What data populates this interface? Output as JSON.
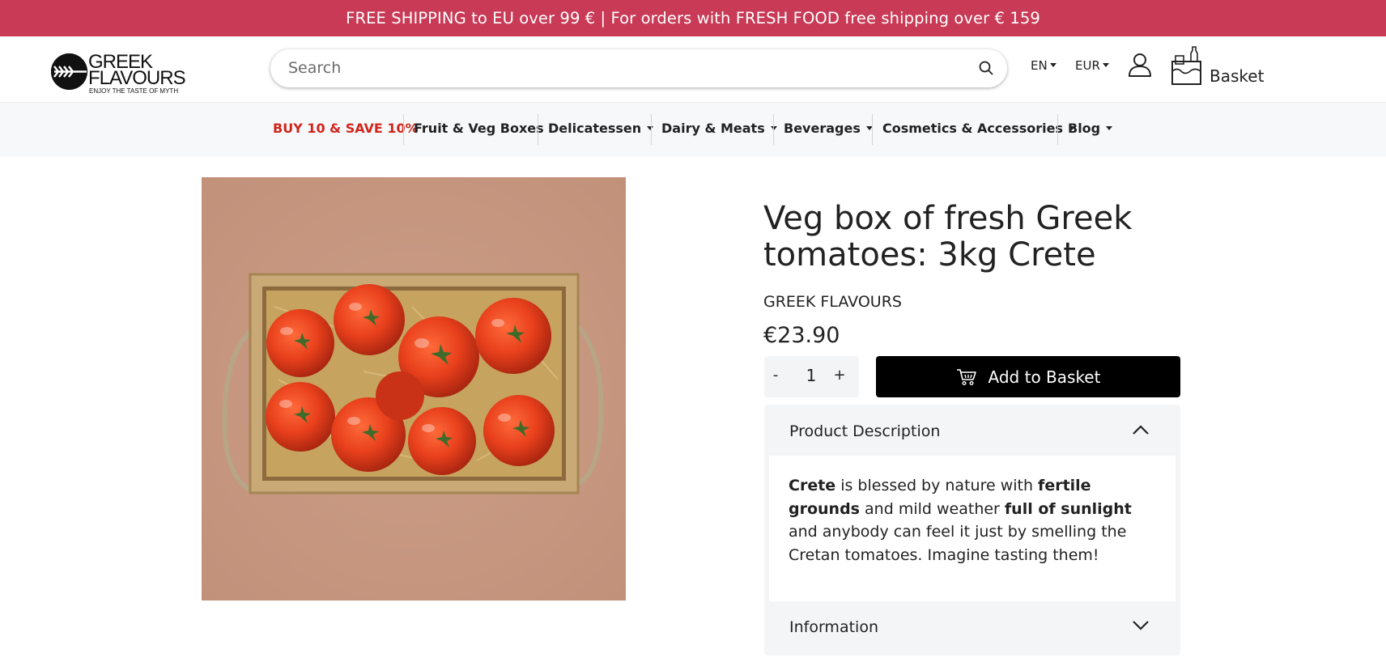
{
  "announcement": {
    "text": "FREE SHIPPING to EU over 99 € | For orders with FRESH FOOD free shipping over € 159",
    "background": "#c83a55"
  },
  "header": {
    "logo": {
      "line1": "GREEK",
      "line2": "FLAVOURS",
      "tagline": "ENJOY THE TASTE OF MYTH"
    },
    "search": {
      "placeholder": "Search",
      "icon": "search-icon"
    },
    "language": "EN",
    "currency": "EUR",
    "account_icon": "user-icon",
    "basket": {
      "label": "Basket",
      "icon": "shopping-bag-icon"
    }
  },
  "nav": {
    "items": [
      {
        "label": "BUY 10 & SAVE 10%",
        "promo": true,
        "dropdown": false
      },
      {
        "label": "Fruit & Veg Boxes",
        "promo": false,
        "dropdown": false
      },
      {
        "label": "Delicatessen",
        "promo": false,
        "dropdown": true
      },
      {
        "label": "Dairy & Meats",
        "promo": false,
        "dropdown": true
      },
      {
        "label": "Beverages",
        "promo": false,
        "dropdown": true
      },
      {
        "label": "Cosmetics & Accessories",
        "promo": false,
        "dropdown": true
      },
      {
        "label": "Blog",
        "promo": false,
        "dropdown": true
      }
    ],
    "promo_color": "#d1251b"
  },
  "product": {
    "title": "Veg box of fresh Greek tomatoes: 3kg Crete",
    "brand": "GREEK FLAVOURS",
    "price": "€23.90",
    "image_alt": "Wooden crate of fresh red tomatoes on straw",
    "quantity": {
      "minus": "-",
      "value": "1",
      "plus": "+"
    },
    "add_to_basket": "Add to Basket",
    "description": {
      "heading": "Product Description",
      "expanded": true,
      "segments": [
        {
          "text": "Crete",
          "bold": true
        },
        {
          "text": " is blessed by nature with ",
          "bold": false
        },
        {
          "text": "fertile grounds",
          "bold": true
        },
        {
          "text": " and mild weather ",
          "bold": false
        },
        {
          "text": "full of sunlight",
          "bold": true
        },
        {
          "text": " and anybody can feel it just by smelling the Cretan tomatoes. Imagine tasting them!",
          "bold": false
        }
      ]
    },
    "information": {
      "heading": "Information",
      "expanded": false
    }
  }
}
